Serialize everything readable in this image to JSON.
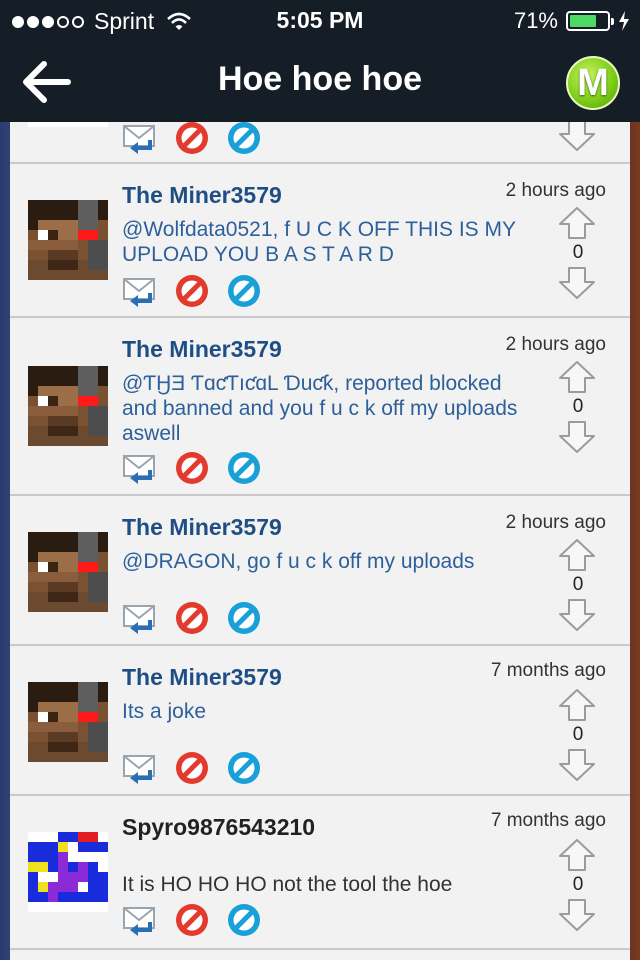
{
  "status_bar": {
    "carrier": "Sprint",
    "time": "5:05 PM",
    "battery": "71%",
    "battery_level": 0.71,
    "battery_color": "#4cd964"
  },
  "nav": {
    "title": "Hoe hoe hoe",
    "back_icon": "arrow-left-icon",
    "logo_letter": "M"
  },
  "comments": [
    {
      "username": "The Miner3579",
      "time": "2 hours ago",
      "text": "@Wolfdata0521,  f U C K OFF THIS IS MY UPLOAD YOU B A S T A R D",
      "votes": "0"
    },
    {
      "username": "The Miner3579",
      "time": "2 hours ago",
      "text": "@ƬӇƎ ƬɑƈƬıƈɑL Ɗuƈƙ, reported blocked and banned and you f u c k off my uploads aswell",
      "votes": "0"
    },
    {
      "username": "The Miner3579",
      "time": "2 hours ago",
      "text": "@DRAGON, go f u c k off my uploads",
      "votes": "0"
    },
    {
      "username": "The Miner3579",
      "time": "7 months ago",
      "text": "Its a joke",
      "votes": "0"
    },
    {
      "username": "Spyro9876543210",
      "time": "7 months ago",
      "text": "It is HO HO HO not the tool the hoe",
      "votes": "0"
    }
  ],
  "colors": {
    "username_link": "#1f4e85",
    "comment_link": "#2d5f9b",
    "block_icon": "#e23b2e",
    "ban_icon": "#1aa0d8"
  }
}
